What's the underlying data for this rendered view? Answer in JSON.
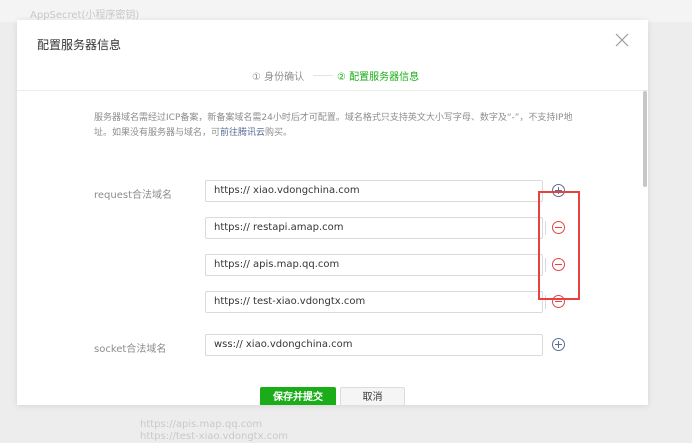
{
  "background": {
    "title": "AppSecret(小程序密钥)",
    "lines": [
      "https://apis.map.qq.com",
      "https://test-xiao.vdongtx.com"
    ]
  },
  "dialog": {
    "title": "配置服务器信息",
    "close_icon": "close-icon",
    "steps": [
      {
        "label": "① 身份确认",
        "active": false
      },
      {
        "label": "② 配置服务器信息",
        "active": true
      }
    ],
    "notice_part1": "服务器域名需经过ICP备案，新备案域名需24小时后才可配置。域名格式只支持英文大小写字母、数字及“-”，不支持IP地址。如果没有服务器与域名，可",
    "notice_link": "前往腾讯云",
    "notice_part2": "购买。",
    "request": {
      "label": "request合法域名",
      "domains": [
        "https:// xiao.vdongchina.com",
        "https:// restapi.amap.com",
        "https:// apis.map.qq.com",
        "https:// test-xiao.vdongtx.com"
      ]
    },
    "socket": {
      "label": "socket合法域名",
      "domains": [
        "wss:// xiao.vdongchina.com"
      ]
    },
    "submit_label": "保存并提交",
    "cancel_label": "取消"
  },
  "colors": {
    "accent": "#1aad19",
    "danger": "#e64340",
    "link": "#576b95"
  }
}
